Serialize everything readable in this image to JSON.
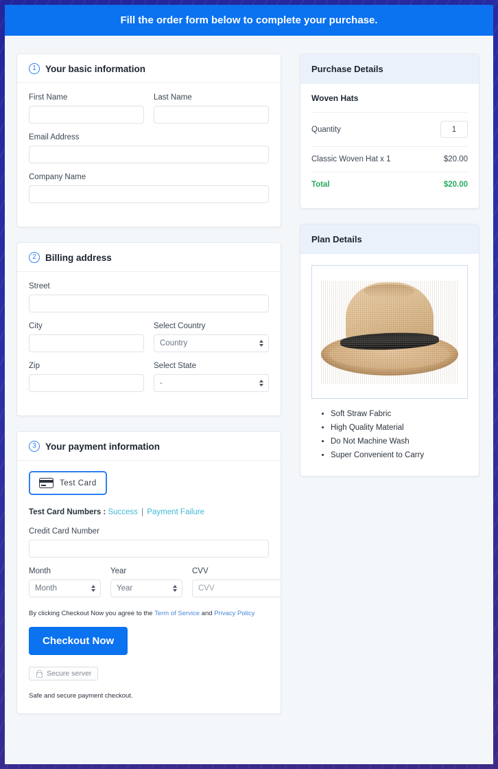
{
  "banner": {
    "text": "Fill the order form below to complete your purchase."
  },
  "theme": {
    "accent": "#0b72f0",
    "frame": "#2b2f9e",
    "page_bg": "#f4f7fa",
    "panel_head_bg": "#eaf1fb",
    "total_green": "#27ab60",
    "link_blue": "#4a86d8",
    "test_link": "#3fb9d6"
  },
  "steps": [
    {
      "number": "1",
      "title": "Your basic information",
      "fields": {
        "first_name_label": "First Name",
        "first_name_value": "",
        "last_name_label": "Last Name",
        "last_name_value": "",
        "email_label": "Email Address",
        "email_value": "",
        "company_label": "Company Name",
        "company_value": ""
      }
    },
    {
      "number": "2",
      "title": "Billing address",
      "fields": {
        "street_label": "Street",
        "street_value": "",
        "city_label": "City",
        "city_value": "",
        "country_label": "Select Country",
        "country_selected": "Country",
        "zip_label": "Zip",
        "zip_value": "",
        "state_label": "Select State",
        "state_selected": "-"
      }
    },
    {
      "number": "3",
      "title": "Your payment information"
    }
  ],
  "payment": {
    "card_tab_label": "Test  Card",
    "card_tab_icon": "credit-card-icon",
    "test_numbers_label": "Test Card Numbers :",
    "test_success_link": "Success",
    "test_separator": "|",
    "test_failure_link": "Payment Failure",
    "credit_card_label": "Credit Card Number",
    "credit_card_value": "",
    "month_label": "Month",
    "month_selected": "Month",
    "year_label": "Year",
    "year_selected": "Year",
    "cvv_label": "CVV",
    "cvv_placeholder": "CVV",
    "cvv_value": "",
    "cvv_icon": "credit-card-icon",
    "terms_prefix": "By clicking Checkout Now you agree to the",
    "terms_link": "Term of Service",
    "terms_and": "and",
    "privacy_link": "Privacy Policy",
    "checkout_label": "Checkout Now",
    "secure_badge_label": "Secure server",
    "secure_badge_icon": "lock-icon",
    "safe_note": "Safe and secure payment checkout."
  },
  "purchase": {
    "panel_title": "Purchase Details",
    "product_name": "Woven Hats",
    "quantity_label": "Quantity",
    "quantity_value": "1",
    "line_item_label": "Classic Woven Hat x 1",
    "line_item_amount": "$20.00",
    "total_label": "Total",
    "total_amount": "$20.00"
  },
  "plan": {
    "panel_title": "Plan Details",
    "image_alt": "straw-fedora-hat-image",
    "features": [
      "Soft Straw Fabric",
      "High Quality Material",
      "Do Not Machine Wash",
      "Super Convenient to Carry"
    ]
  }
}
